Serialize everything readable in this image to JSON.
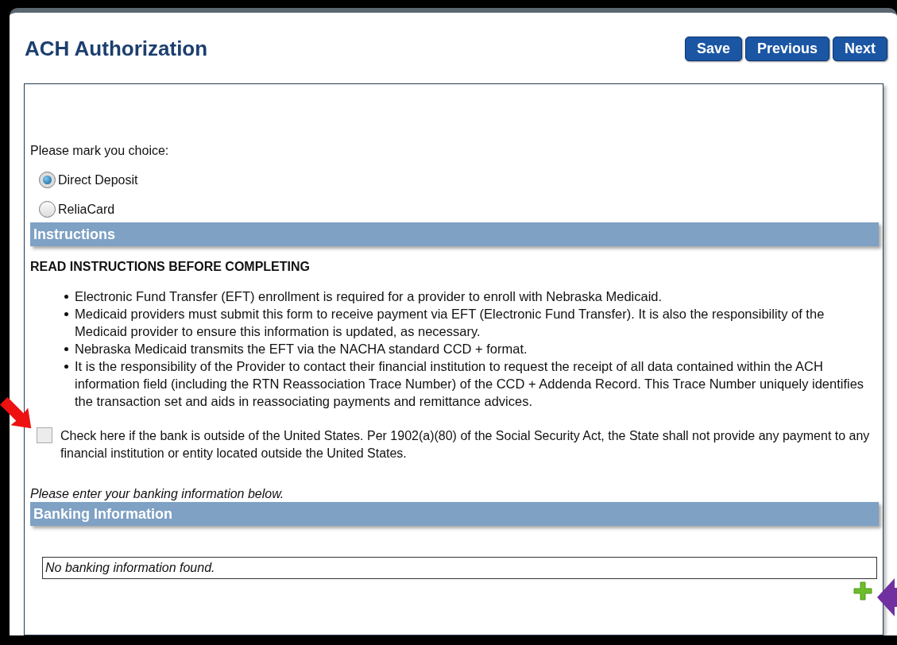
{
  "title": "ACH Authorization",
  "buttons": [
    {
      "label": "Save"
    },
    {
      "label": "Previous"
    },
    {
      "label": "Next"
    }
  ],
  "choice": {
    "prompt": "Please mark you choice:",
    "options": [
      {
        "label": "Direct Deposit",
        "selected": true
      },
      {
        "label": "ReliaCard",
        "selected": false
      }
    ]
  },
  "instructions": {
    "header": "Instructions",
    "heading": "READ INSTRUCTIONS BEFORE COMPLETING",
    "items": [
      "Electronic Fund Transfer (EFT) enrollment is required for a provider to enroll with Nebraska Medicaid.",
      "Medicaid providers must submit this form to receive payment via EFT (Electronic Fund Transfer). It is also the responsibility of the Medicaid provider to ensure this information is updated, as necessary.",
      "Nebraska Medicaid transmits the EFT via the NACHA standard CCD + format.",
      "It is the responsibility of the Provider to contact their financial institution to request the receipt of all data contained within the ACH information field (including the RTN Reassociation Trace Number) of the CCD + Addenda Record. This Trace Number uniquely identifies the transaction set and aids in reassociating payments and remittance advices."
    ]
  },
  "outside_us": {
    "checked": false,
    "label": "Check here if the bank is outside of the United States. Per 1902(a)(80) of the Social Security Act, the State shall not provide any payment to any financial institution or entity located outside the United States."
  },
  "banking": {
    "note": "Please enter your banking information below.",
    "header": "Banking Information",
    "empty_message": "No banking information found."
  }
}
